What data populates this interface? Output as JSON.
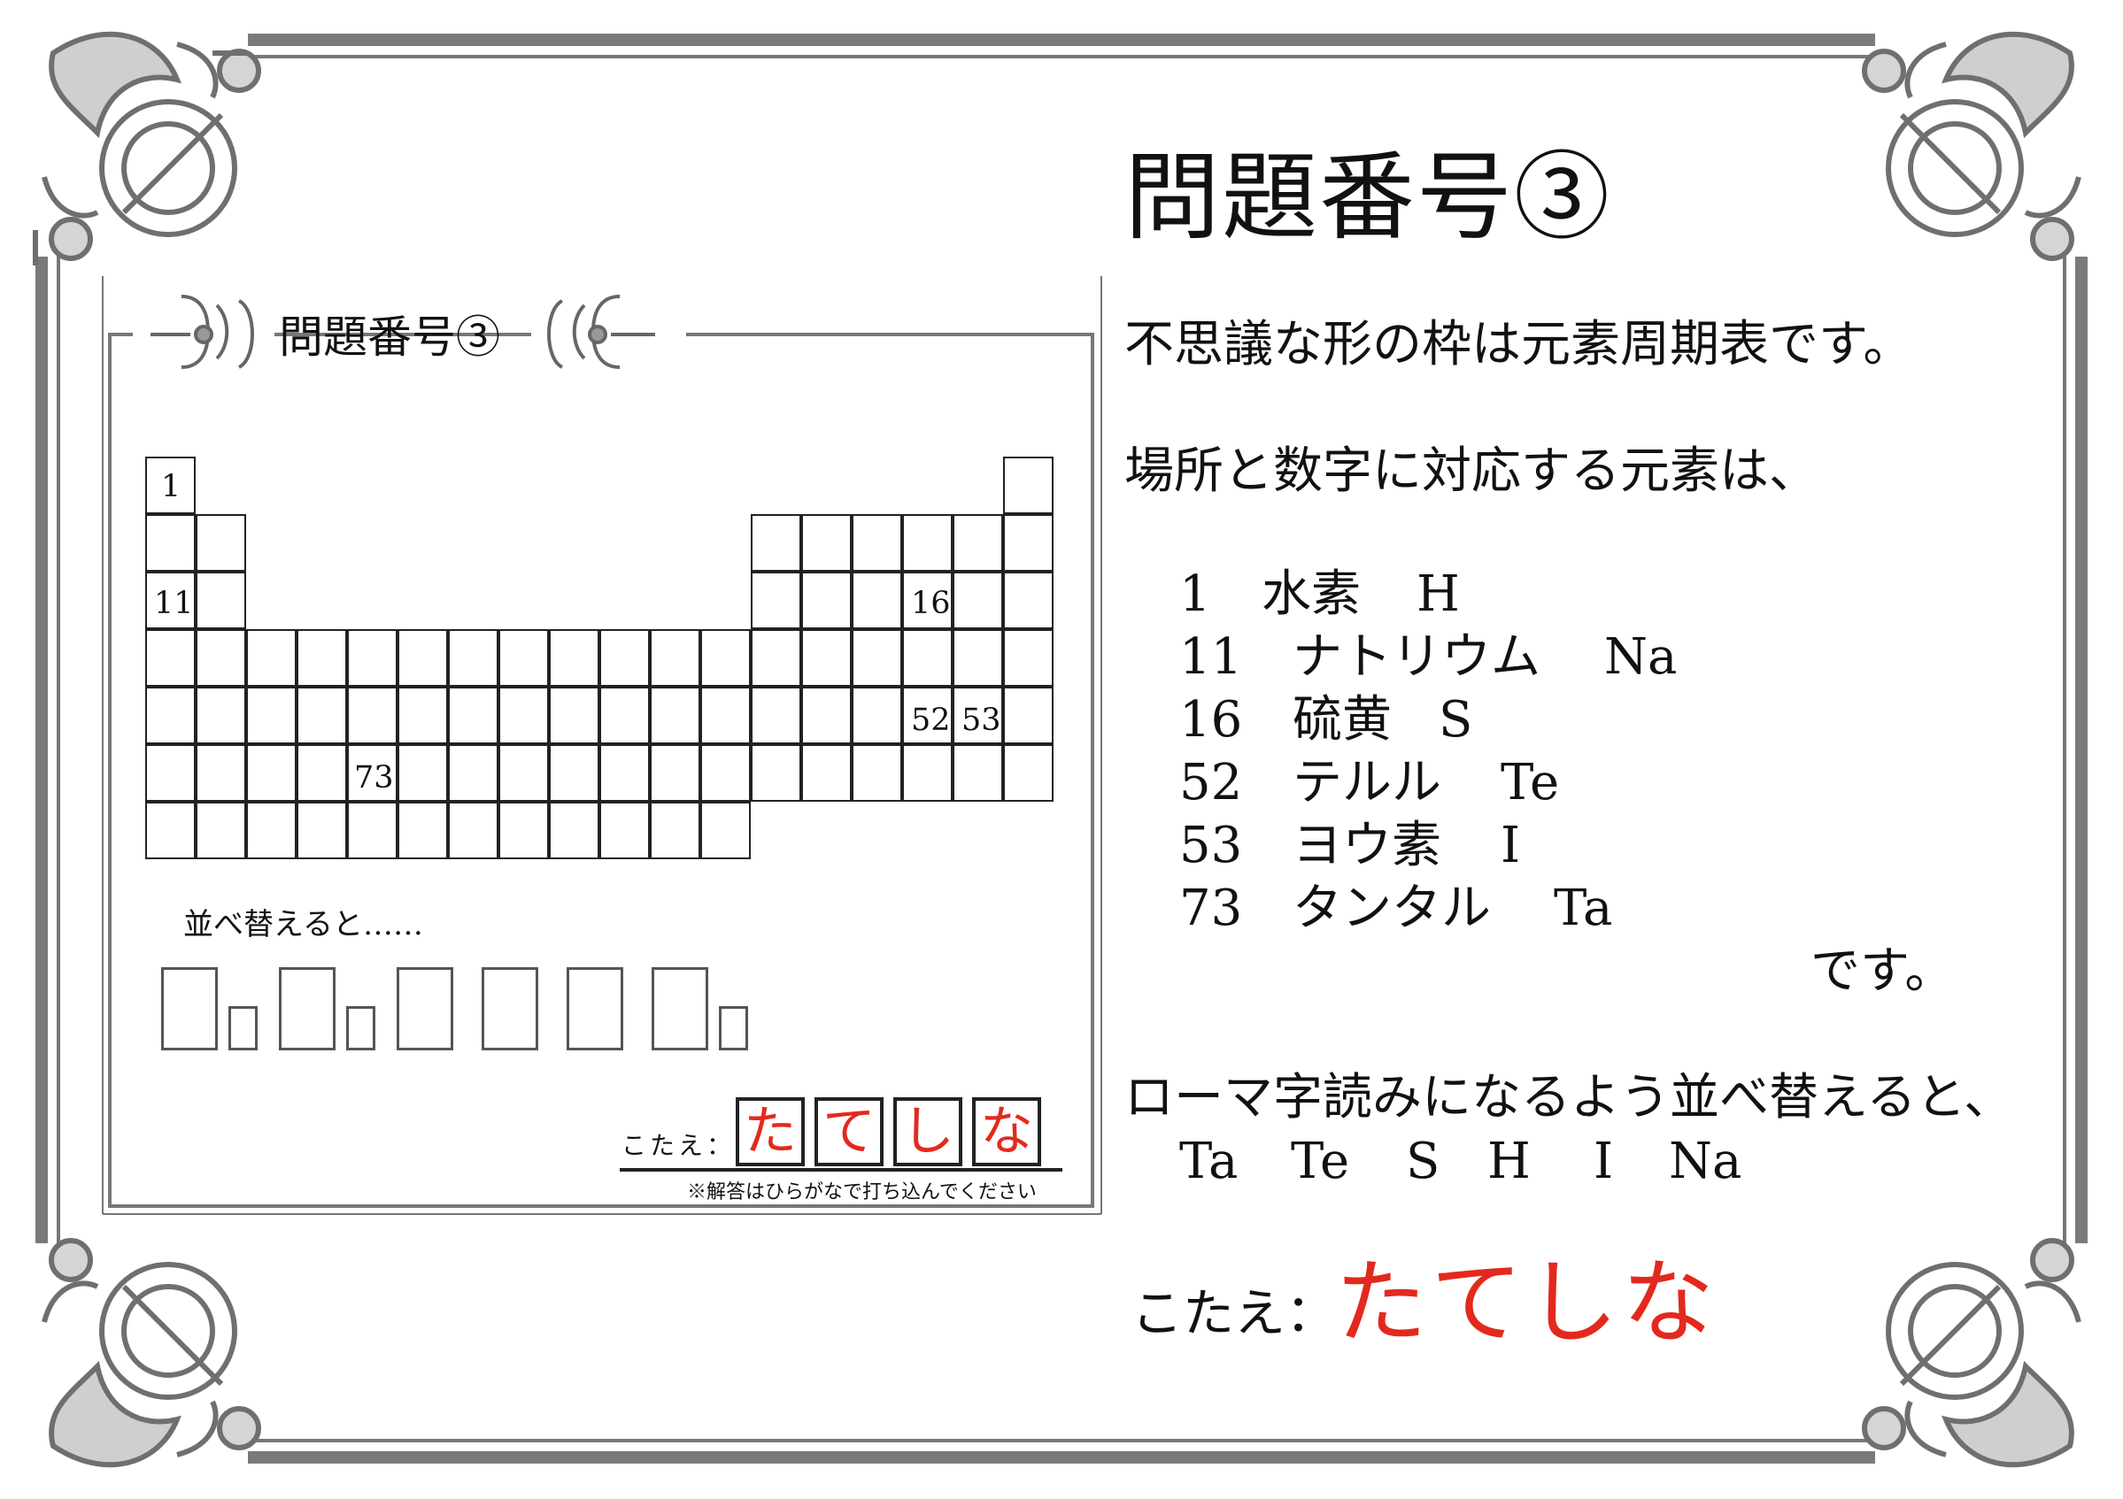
{
  "title": "問題番号③",
  "explanation": {
    "line1": "不思議な形の枠は元素周期表です。",
    "line2": "場所と数字に対応する元素は、",
    "elements": [
      {
        "number": "1",
        "name": "水素",
        "symbol": "H"
      },
      {
        "number": "11",
        "name": "ナトリウム",
        "symbol": "Na"
      },
      {
        "number": "16",
        "name": "硫黄",
        "symbol": "S"
      },
      {
        "number": "52",
        "name": "テルル",
        "symbol": "Te"
      },
      {
        "number": "53",
        "name": "ヨウ素",
        "symbol": "I"
      },
      {
        "number": "73",
        "name": "タンタル",
        "symbol": "Ta"
      }
    ],
    "desu": "です。",
    "romaji_line": "ローマ字読みになるよう並べ替えると、",
    "sorted_symbols": [
      "Ta",
      "Te",
      "S",
      "H",
      "I",
      "Na"
    ],
    "answer_label": "こたえ：",
    "answer": "たてしな"
  },
  "puzzle_card": {
    "title": "問題番号③",
    "cell_numbers": [
      "1",
      "11",
      "16",
      "52",
      "53",
      "73"
    ],
    "sort_label": "並べ替えると……",
    "answer_label": "こたえ：",
    "answer_chars": [
      "た",
      "て",
      "し",
      "な"
    ],
    "note": "※解答はひらがなで打ち込んでください"
  },
  "colors": {
    "answer": "#e3291d",
    "frame": "#7a7a7a",
    "ink": "#111111"
  }
}
